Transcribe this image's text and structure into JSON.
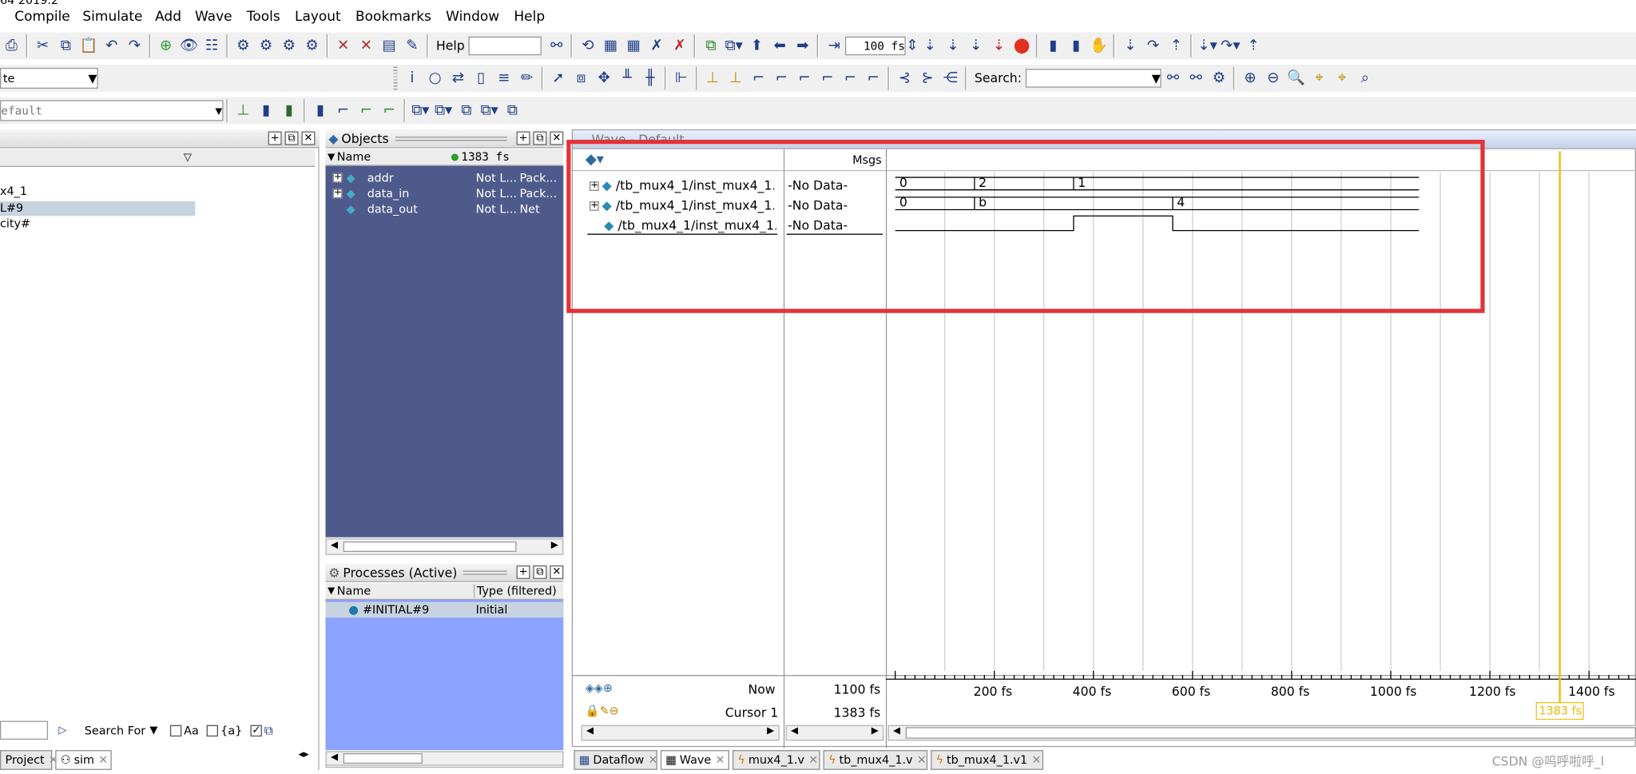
{
  "title_fragment": "64 2019.2",
  "menu": [
    "Compile",
    "Simulate",
    "Add",
    "Wave",
    "Tools",
    "Layout",
    "Bookmarks",
    "Window",
    "Help"
  ],
  "toolbar": {
    "help_label": "Help",
    "help_value": "",
    "runtime_value": "100 fs",
    "search_label": "Search:",
    "search_value": "",
    "combo1_value": "te",
    "combo2_value": "efault"
  },
  "structure_panel": {
    "items": [
      "x4_1",
      "L#9",
      "city#"
    ],
    "search_for_label": "Search For",
    "aa_label": "Aa",
    "regex_label": "{a}"
  },
  "objects_panel": {
    "title": "Objects",
    "col_name": "Name",
    "time_value": "1383 fs",
    "rows": [
      {
        "name": "addr",
        "value": "Not L...",
        "kind": "Pack..."
      },
      {
        "name": "data_in",
        "value": "Not L...",
        "kind": "Pack..."
      },
      {
        "name": "data_out",
        "value": "Not L...",
        "kind": "Net"
      }
    ]
  },
  "processes_panel": {
    "title": "Processes (Active)",
    "col_name": "Name",
    "col_type": "Type (filtered)",
    "rows": [
      {
        "name": "#INITIAL#9",
        "type": "Initial"
      }
    ]
  },
  "wave": {
    "title": "Wave - Default",
    "msgs_label": "Msgs",
    "signals": [
      {
        "path": "/tb_mux4_1/inst_mux4_1...",
        "msg": "-No Data-",
        "values": [
          "0",
          "2",
          "1"
        ]
      },
      {
        "path": "/tb_mux4_1/inst_mux4_1...",
        "msg": "-No Data-",
        "values": [
          "0",
          "b",
          "4"
        ]
      },
      {
        "path": "/tb_mux4_1/inst_mux4_1...",
        "msg": "-No Data-",
        "values": []
      }
    ],
    "now_label": "Now",
    "now_value": "1100 fs",
    "cursor_label": "Cursor 1",
    "cursor_value": "1383 fs",
    "cursor_flag": "1383 fs",
    "ticks": [
      "200 fs",
      "400 fs",
      "600 fs",
      "800 fs",
      "1000 fs",
      "1200 fs",
      "1400 fs"
    ]
  },
  "tabs_left": [
    "Project",
    "sim"
  ],
  "tabs_wave": [
    "Dataflow",
    "Wave",
    "mux4_1.v",
    "tb_mux4_1.v",
    "tb_mux4_1.v1"
  ],
  "watermark": "CSDN @呜呼啦呼_l",
  "colors": {
    "objects_bg": "#4f5a8c",
    "processes_bg": "#8ca2ff",
    "highlight_box": "#e53237",
    "cursor": "#f2c21a"
  }
}
